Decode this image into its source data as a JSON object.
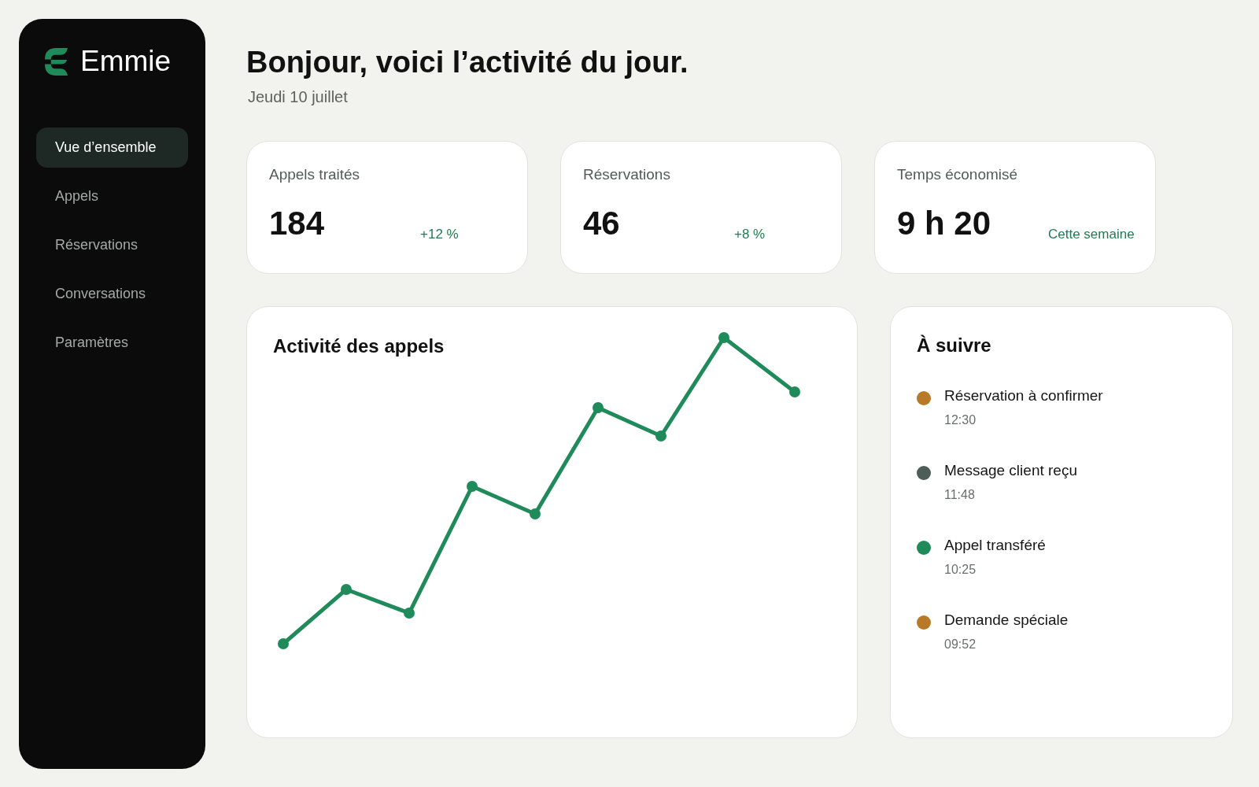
{
  "sidebar": {
    "logo": {
      "name": "Emmie"
    },
    "items": [
      {
        "label": "Vue d’ensemble",
        "selected": true
      },
      {
        "label": "Appels",
        "selected": false
      },
      {
        "label": "Réservations",
        "selected": false
      },
      {
        "label": "Conversations",
        "selected": false
      },
      {
        "label": "Paramètres",
        "selected": false
      }
    ]
  },
  "header": {
    "title": "Bonjour, voici l’activité du jour.",
    "date": "Jeudi 10 juillet"
  },
  "stats": [
    {
      "label": "Appels traités",
      "value": "184",
      "note": "+12 %"
    },
    {
      "label": "Réservations",
      "value": "46",
      "note": "+8 %"
    },
    {
      "label": "Temps économisé",
      "value": "9 h 20",
      "note": "Cette semaine"
    }
  ],
  "activity_chart": {
    "title": "Activité des appels"
  },
  "follow_up": {
    "title": "À suivre",
    "items": [
      {
        "label": "Réservation à confirmer",
        "time": "12:30",
        "color": "#b87a26"
      },
      {
        "label": "Message client reçu",
        "time": "11:48",
        "color": "#4e5d57"
      },
      {
        "label": "Appel transféré",
        "time": "10:25",
        "color": "#1f8a5a"
      },
      {
        "label": "Demande spéciale",
        "time": "09:52",
        "color": "#b87a26"
      }
    ]
  }
}
